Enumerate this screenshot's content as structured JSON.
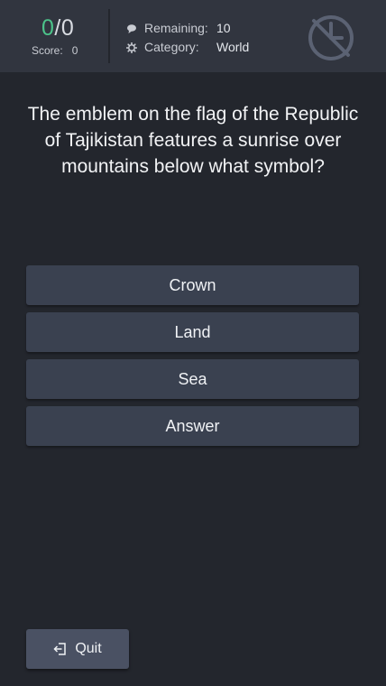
{
  "header": {
    "score_correct": "0",
    "score_separator": "/",
    "score_total": "0",
    "score_label": "Score:",
    "score_value": "0",
    "remaining_label": "Remaining:",
    "remaining_value": "10",
    "category_label": "Category:",
    "category_value": "World",
    "icons": {
      "remaining": "comment-icon",
      "category": "gear-icon",
      "timer": "timer-off-icon"
    }
  },
  "question": {
    "text": "The emblem on the flag of the Republic of Tajikistan features a sunrise over mountains below what symbol?"
  },
  "answers": [
    {
      "label": "Crown"
    },
    {
      "label": "Land"
    },
    {
      "label": "Sea"
    },
    {
      "label": "Answer"
    }
  ],
  "footer": {
    "quit_label": "Quit",
    "quit_icon": "exit-icon"
  },
  "colors": {
    "background": "#23262d",
    "header": "#31353f",
    "answer_button": "#3a4150",
    "quit_button": "#4a5163",
    "score_correct": "#4cc38a"
  }
}
